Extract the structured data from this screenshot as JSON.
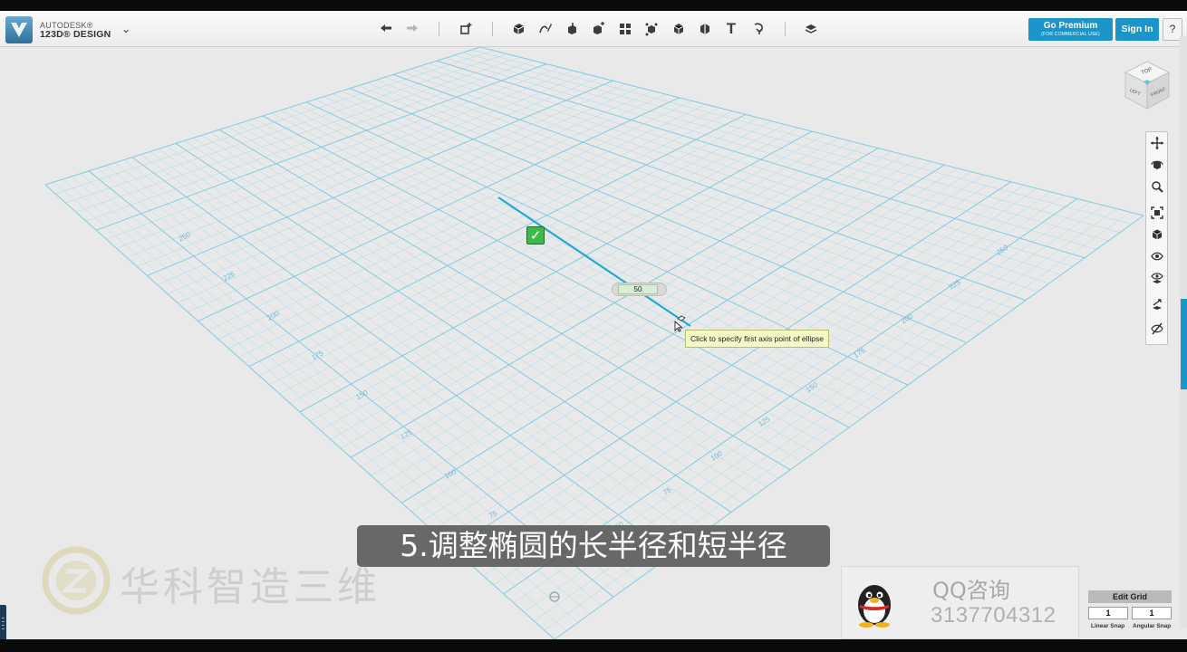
{
  "app": {
    "brand_line1": "AUTODESK®",
    "brand_line2": "123D® DESIGN",
    "accent_color": "#1a94c9"
  },
  "toolbar": {
    "tools": [
      {
        "name": "undo-icon"
      },
      {
        "name": "redo-icon"
      },
      {
        "name": "transform-icon"
      },
      {
        "name": "primitives-icon"
      },
      {
        "name": "sketch-icon"
      },
      {
        "name": "construct-icon"
      },
      {
        "name": "modify-icon"
      },
      {
        "name": "pattern-icon"
      },
      {
        "name": "grouping-icon"
      },
      {
        "name": "combine-icon"
      },
      {
        "name": "measure-icon"
      },
      {
        "name": "text-icon"
      },
      {
        "name": "snap-icon"
      },
      {
        "name": "materials-icon"
      }
    ],
    "text_tool_glyph": "T",
    "premium_label": "Go Premium",
    "premium_sublabel": "(FOR COMMERCIAL USE)",
    "signin_label": "Sign In",
    "help_label": "?"
  },
  "viewcube": {
    "top": "TOP",
    "left": "LEFT",
    "front": "FRONT"
  },
  "nav_panel": {
    "tools": [
      "pan-icon",
      "orbit-icon",
      "zoom-icon",
      "fit-icon",
      "views-icon",
      "visibility-icon",
      "material-visibility-icon",
      "grid-snap-icon",
      "hide-icon"
    ]
  },
  "sketch": {
    "dimension_value": "50",
    "tooltip": "Click to specify first axis point of ellipse"
  },
  "grid_labels": {
    "left_axis": [
      "250",
      "225",
      "200",
      "175",
      "150",
      "125",
      "100",
      "75",
      "50"
    ],
    "right_axis": [
      "25",
      "50",
      "75",
      "100",
      "125",
      "150",
      "175",
      "200",
      "225",
      "250"
    ]
  },
  "subtitle": "5.调整椭圆的长半径和短半径",
  "watermark": "华科智造三维",
  "qq": {
    "title": "QQ咨询",
    "number": "3137704312"
  },
  "grid_settings": {
    "edit_grid_label": "Edit Grid",
    "linear_snap_value": "1",
    "angular_snap_value": "1",
    "linear_snap_label": "Linear Snap",
    "angular_snap_label": "Angular Snap"
  }
}
